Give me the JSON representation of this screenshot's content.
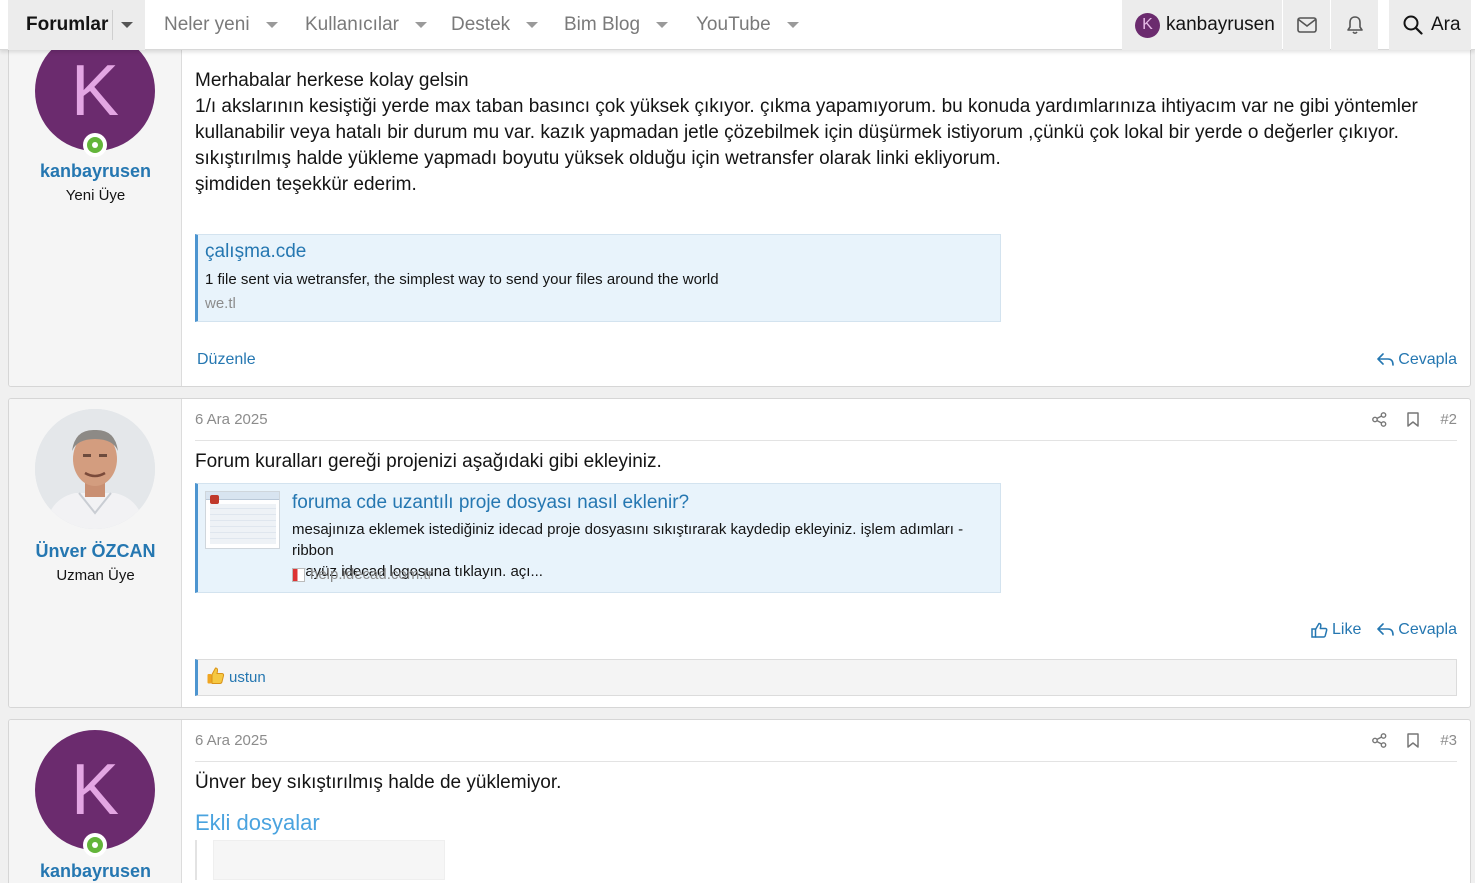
{
  "nav": {
    "forums": "Forumlar",
    "items": [
      "Neler yeni",
      "Kullanıcılar",
      "Destek",
      "Bim Blog",
      "YouTube"
    ],
    "user": {
      "initial": "K",
      "name": "kanbayrusen"
    },
    "search": "Ara",
    "mail_icon": "envelope-icon",
    "bell_icon": "bell-icon"
  },
  "posts": [
    {
      "user": {
        "initial": "K",
        "name": "kanbayrusen",
        "title": "Yeni Üye",
        "online": true
      },
      "body": [
        "Merhabalar herkese kolay gelsin",
        "1/ı akslarının kesiştiği yerde max taban basıncı çok yüksek çıkıyor. çıkma yapamıyorum. bu konuda yardımlarınıza ihtiyacım var ne gibi yöntemler",
        "kullanabilir veya hatalı bir durum mu var. kazık yapmadan jetle çözebilmek için düşürmek istiyorum ,çünkü çok lokal bir yerde o değerler çıkıyor.",
        "sıkıştırılmış halde yükleme yapmadı boyutu yüksek olduğu için wetransfer olarak linki ekliyorum.",
        "şimdiden teşekkür ederim."
      ],
      "unfurl": {
        "title": "çalışma.cde",
        "desc": "1 file sent via wetransfer, the simplest way to send your files around the world",
        "domain": "we.tl"
      },
      "actions": {
        "edit": "Düzenle",
        "reply": "Cevapla"
      }
    },
    {
      "date": "6 Ara 2025",
      "number": "#2",
      "user": {
        "name": "Ünver ÖZCAN",
        "title": "Uzman Üye"
      },
      "body": "Forum kuralları gereği projenizi aşağıdaki gibi ekleyiniz.",
      "unfurl": {
        "title": "foruma cde uzantılı proje dosyası nasıl eklenir?",
        "desc_line1": "mesajınıza eklemek istediğiniz idecad proje dosyasını sıkıştırarak kaydedip ekleyiniz. işlem adımları - ribbon",
        "desc_line2": "arayüz idecad logosuna tıklayın. açı...",
        "domain": "help.idecad.com.tr"
      },
      "actions": {
        "like": "Like",
        "reply": "Cevapla"
      },
      "reaction": "ustun"
    },
    {
      "date": "6 Ara 2025",
      "number": "#3",
      "user": {
        "initial": "K",
        "name": "kanbayrusen",
        "online": true
      },
      "body": "Ünver bey sıkıştırılmış halde de yüklemiyor.",
      "attachments_title": "Ekli dosyalar"
    }
  ]
}
